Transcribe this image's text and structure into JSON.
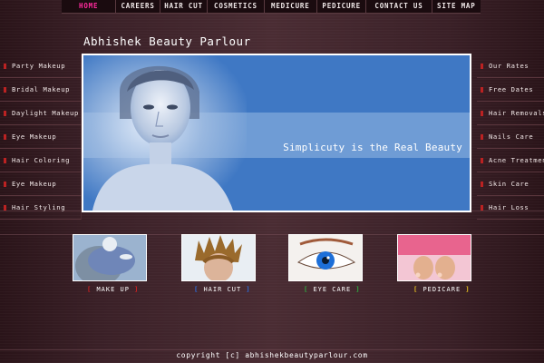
{
  "top_nav": [
    {
      "label": "HOME",
      "active": true
    },
    {
      "label": "CAREERS"
    },
    {
      "label": "HAIR CUT"
    },
    {
      "label": "COSMETICS"
    },
    {
      "label": "MEDICURE"
    },
    {
      "label": "PEDICURE"
    },
    {
      "label": "CONTACT US"
    },
    {
      "label": "SITE MAP"
    }
  ],
  "site_title": "Abhishek Beauty Parlour",
  "left_menu": [
    "Party Makeup",
    "Bridal Makeup",
    "Daylight Makeup",
    "Eye Makeup",
    "Hair Coloring",
    "Eye Makeup",
    "Hair Styling"
  ],
  "right_menu": [
    "Our Rates",
    "Free Dates",
    "Hair Removals",
    "Nails Care",
    "Acne Treatment",
    "Skin Care",
    "Hair Loss"
  ],
  "banner": {
    "tagline": "Simplicuty is the Real Beauty"
  },
  "thumbnails": [
    {
      "caption": "MAKE UP",
      "bracket_color": "#d02020"
    },
    {
      "caption": "HAIR CUT",
      "bracket_color": "#2a6fe0"
    },
    {
      "caption": "EYE CARE",
      "bracket_color": "#2cb040"
    },
    {
      "caption": "PEDICARE",
      "bracket_color": "#e6c020"
    }
  ],
  "footer": "copyright [c] abhishekbeautyparlour.com",
  "colors": {
    "active_nav": "#ff2a9c",
    "banner_blue": "#3f78c4",
    "bullet": "#b22222"
  }
}
